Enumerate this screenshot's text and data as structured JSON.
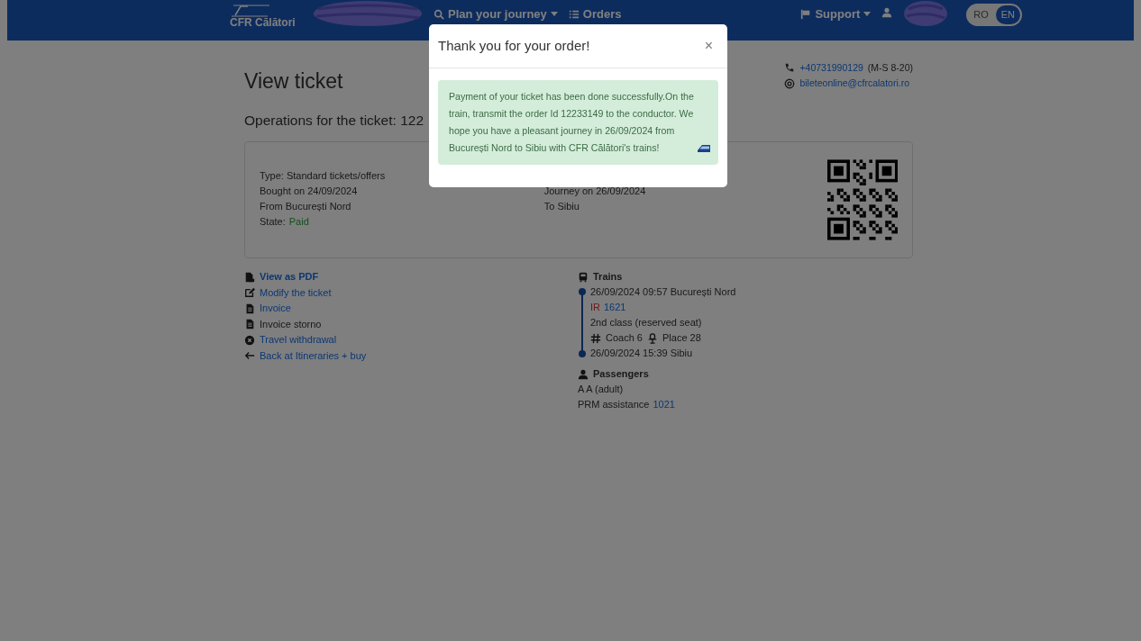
{
  "navbar": {
    "logo_text": "CFR Călători",
    "menu": [
      {
        "label": "Plan your journey",
        "kind": "search",
        "dropdown": true
      },
      {
        "label": "Orders",
        "kind": "list",
        "dropdown": false
      },
      {
        "label": "Support",
        "kind": "flag",
        "dropdown": true
      }
    ],
    "languages": [
      {
        "label": "RO",
        "selected": false
      },
      {
        "label": "EN",
        "selected": true
      }
    ]
  },
  "contact": {
    "phone": "+40731990129",
    "hours": "(M-S 8-20)",
    "email": "bileteonline@cfrcalatori.ro"
  },
  "page_title": "View ticket",
  "operations_heading": "Operations for the ticket: 122",
  "ticket": {
    "left": [
      "Type: Standard tickets/offers",
      "Bought on 24/09/2024",
      "From București Nord"
    ],
    "state_label": "State:",
    "state": "Paid",
    "right": [
      "Journey on 26/09/2024",
      "To Sibiu"
    ]
  },
  "actions": [
    {
      "label": "View as PDF",
      "kind": "pdf",
      "link": true,
      "bold": true
    },
    {
      "label": "Modify the ticket",
      "kind": "edit",
      "link": true,
      "bold": false
    },
    {
      "label": "Invoice",
      "kind": "file",
      "link": true,
      "bold": false
    },
    {
      "label": "Invoice storno",
      "kind": "file",
      "link": false,
      "bold": false
    },
    {
      "label": "Travel withdrawal",
      "kind": "cancel",
      "link": true,
      "bold": false
    },
    {
      "label": "Back at Itineraries + buy",
      "kind": "arrow",
      "link": true,
      "bold": false
    }
  ],
  "trains": {
    "title": "Trains",
    "departure": "26/09/2024 09:57 București Nord",
    "category": "IR",
    "number": "1621",
    "class": "2nd class (reserved seat)",
    "coach": "Coach 6",
    "place": "Place 28",
    "arrival": "26/09/2024 15:39 Sibiu"
  },
  "passengers": {
    "title": "Passengers",
    "items": [
      "A A (adult)"
    ],
    "prm_label": "PRM assistance",
    "prm_number": "1021"
  },
  "modal": {
    "title": "Thank you for your order!",
    "close": "×",
    "message": "Payment of your ticket has been done successfully.On the train, transmit the order Id 12233149 to the conductor. We hope you have a pleasant journey in 26/09/2024 from București Nord to Sibiu with CFR Călători's trains!"
  }
}
